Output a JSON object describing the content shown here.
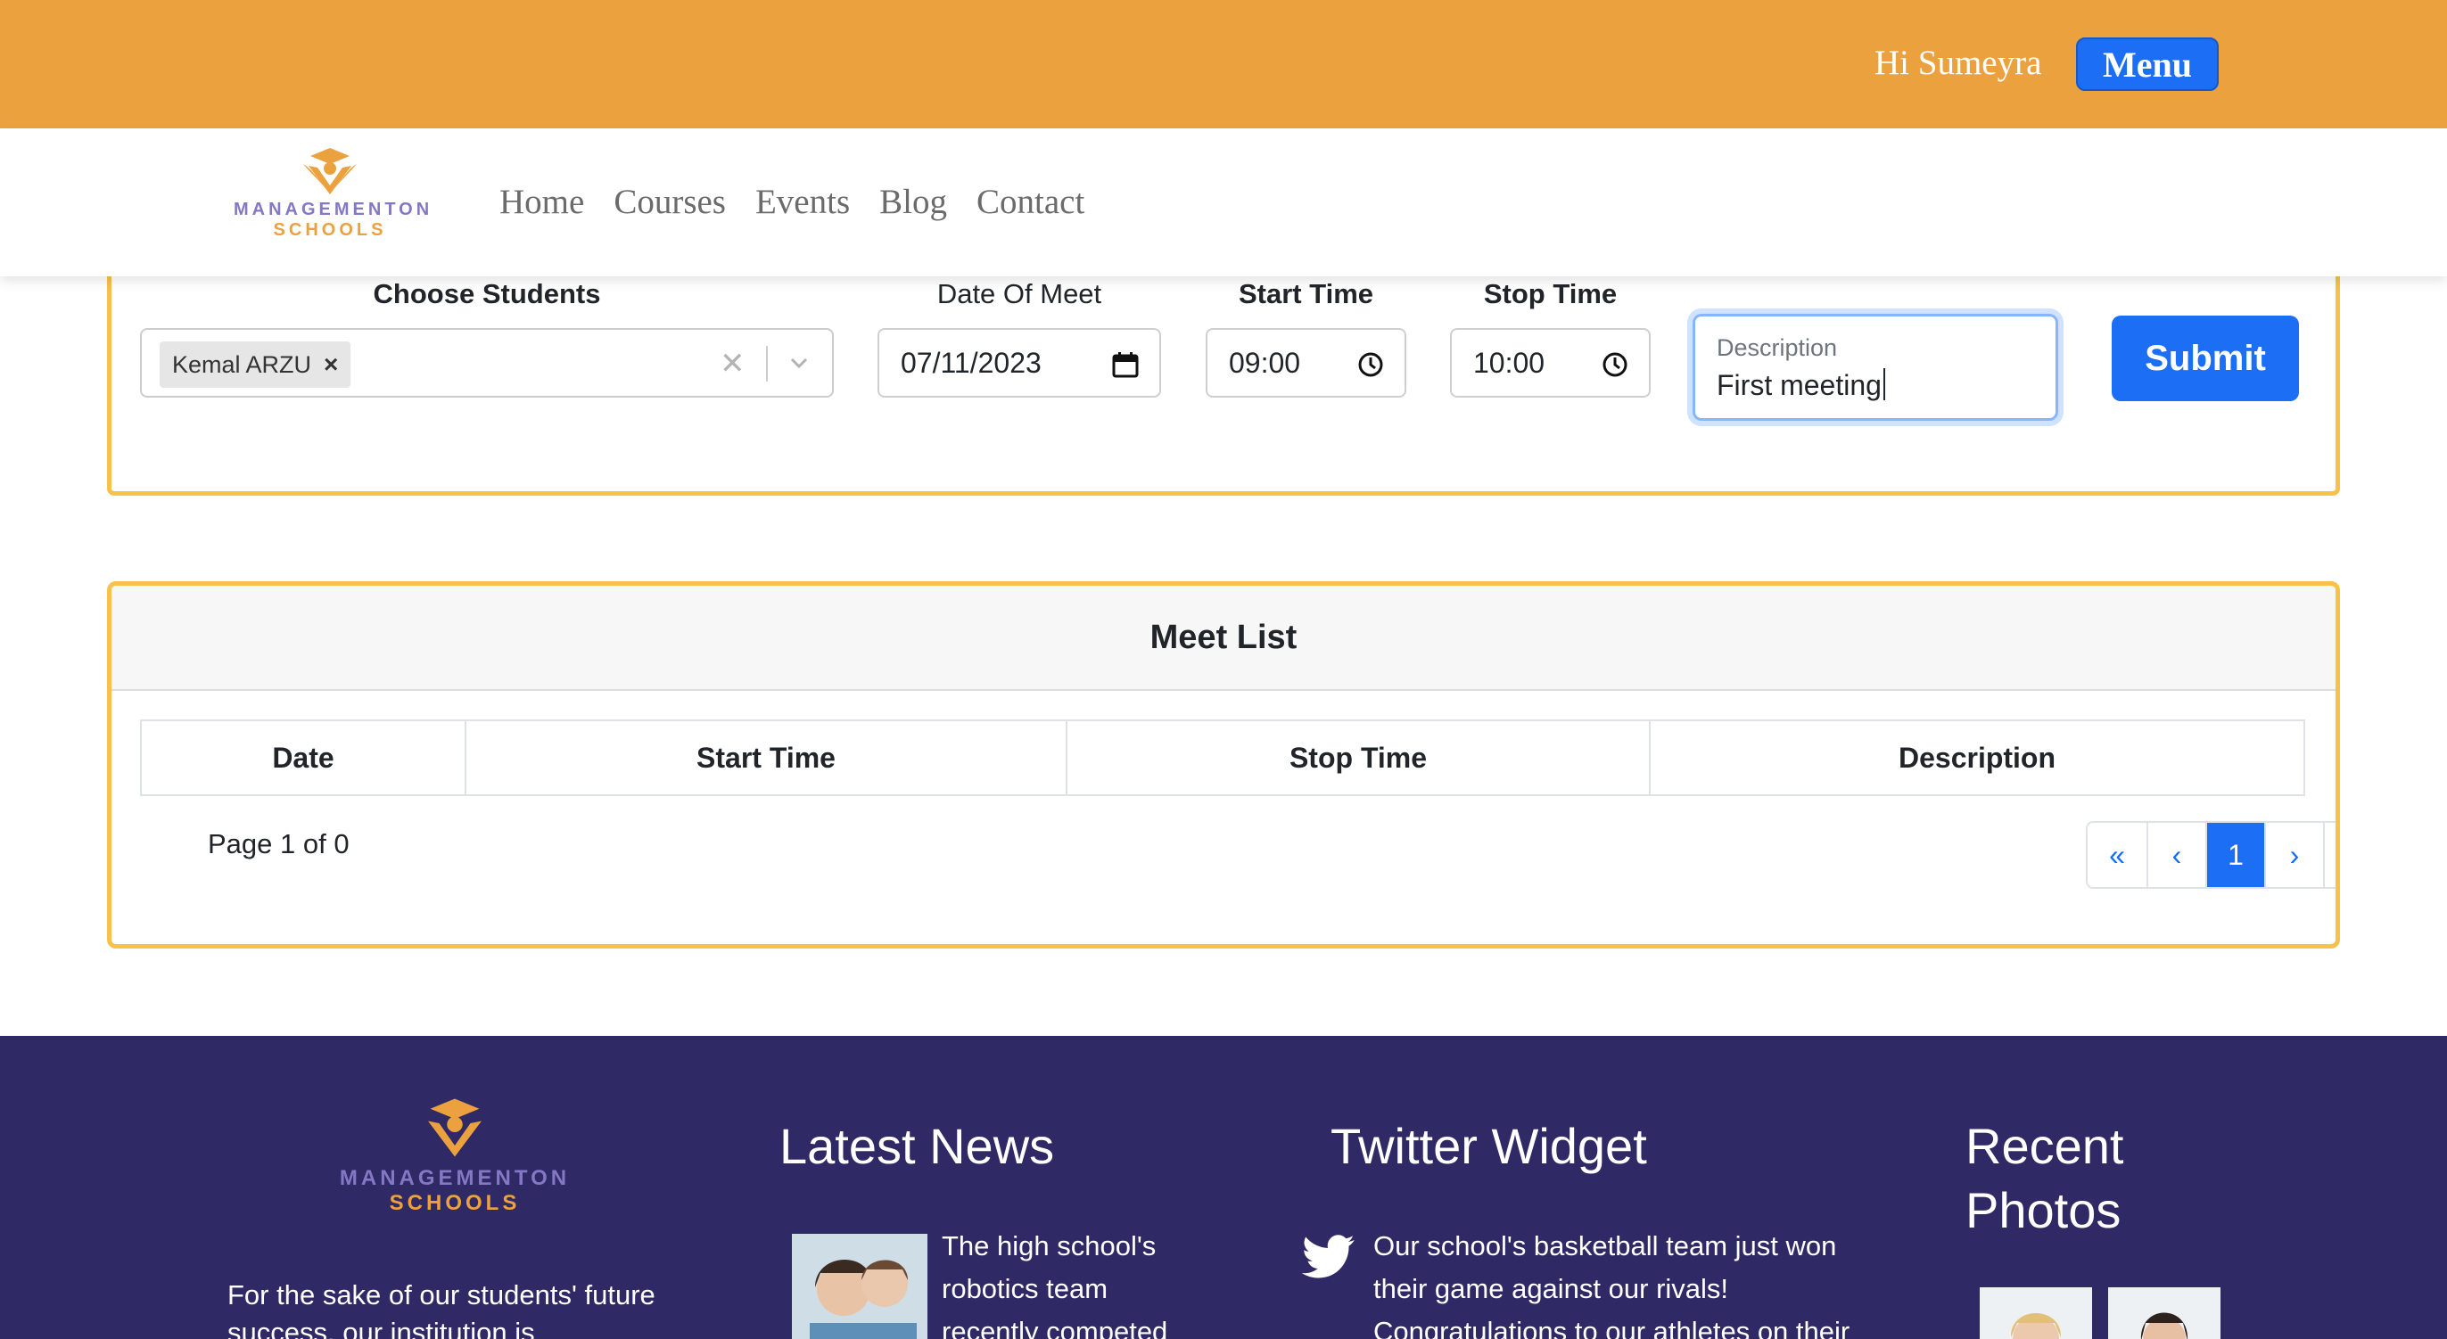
{
  "topbar": {
    "greeting": "Hi Sumeyra",
    "menu_label": "Menu",
    "color": "#eba13e"
  },
  "brand": {
    "line1": "MANAGEMENTON",
    "line2": "SCHOOLS",
    "icon": "graduation-cap-logo-icon"
  },
  "nav": {
    "items": [
      "Home",
      "Courses",
      "Events",
      "Blog",
      "Contact"
    ]
  },
  "form": {
    "labels": {
      "students": "Choose Students",
      "date": "Date Of Meet",
      "start": "Start Time",
      "stop": "Stop Time"
    },
    "selected_student": "Kemal ARZU",
    "date_value": "07/11/2023",
    "start_value": "09:00",
    "stop_value": "10:00",
    "description_placeholder": "Description",
    "description_value": "First meeting",
    "submit_label": "Submit"
  },
  "meet_list": {
    "title": "Meet List",
    "columns": [
      "Date",
      "Start Time",
      "Stop Time",
      "Description"
    ],
    "page_info": "Page 1 of 0",
    "pagination": [
      "«",
      "‹",
      "1",
      "›",
      "»"
    ],
    "active_page": "1"
  },
  "footer": {
    "about": "For the sake of our students' future success, our institution is",
    "news_heading": "Latest News",
    "news_item": "The high school's robotics team recently competed",
    "twitter_heading": "Twitter Widget",
    "tweet": "Our school's basketball team just won their game against our rivals! Congratulations to our athletes on their",
    "photos_heading": "Recent Photos"
  },
  "colors": {
    "accent_blue": "#1c6ff5",
    "card_border": "#f8c14a",
    "footer_bg": "#2f2966"
  }
}
